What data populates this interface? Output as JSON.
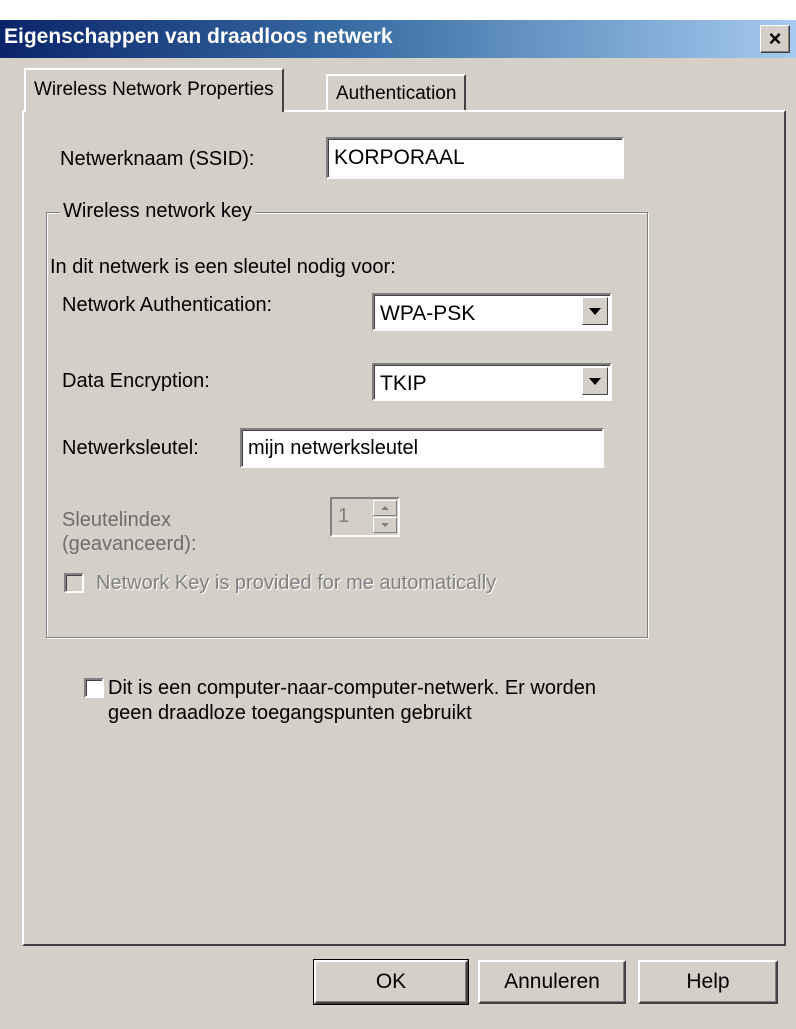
{
  "window": {
    "title": "Eigenschappen van draadloos netwerk",
    "close_label": "×"
  },
  "tabs": [
    {
      "label": "Wireless Network Properties",
      "active": true
    },
    {
      "label": "Authentication",
      "active": false
    }
  ],
  "ssid": {
    "label": "Netwerknaam (SSID):",
    "value": "KORPORAAL"
  },
  "key_group": {
    "title": "Wireless network key",
    "intro": "In dit netwerk is een sleutel nodig voor:",
    "auth": {
      "label": "Network Authentication:",
      "value": "WPA-PSK"
    },
    "encryption": {
      "label": "Data Encryption:",
      "value": "TKIP"
    },
    "netkey": {
      "label": "Netwerksleutel:",
      "value": "mijn netwerksleutel"
    },
    "keyindex": {
      "label_line1": "Sleutelindex",
      "label_line2": "(geavanceerd):",
      "value": "1"
    },
    "auto_key": {
      "label": "Network Key is provided for me automatically",
      "checked": false,
      "disabled": true
    }
  },
  "adhoc": {
    "line1": "Dit is een computer-naar-computer-netwerk. Er worden",
    "line2": "geen draadloze toegangspunten gebruikt",
    "checked": false
  },
  "buttons": {
    "ok": "OK",
    "cancel": "Annuleren",
    "help": "Help"
  },
  "colors": {
    "title_start": "#0a246a",
    "title_end": "#a6caf0",
    "face": "#d4d0c8"
  }
}
